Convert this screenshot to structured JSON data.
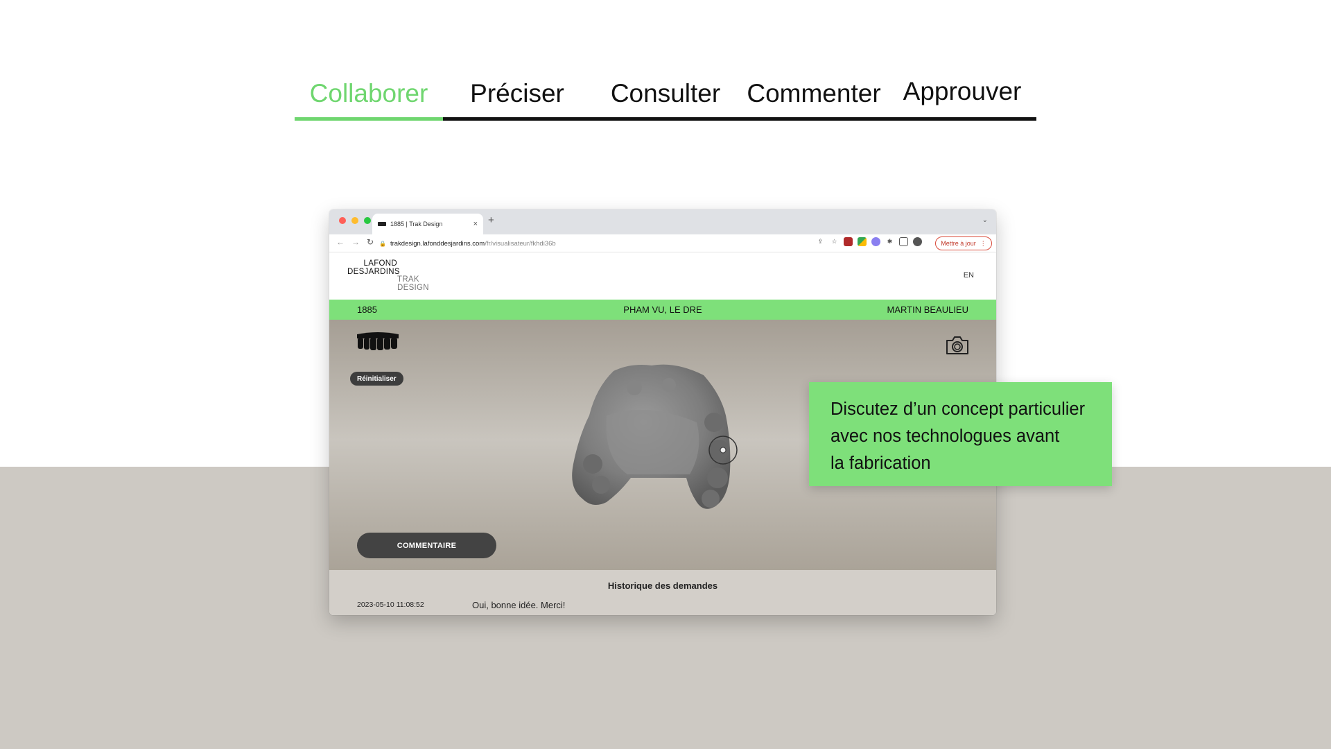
{
  "tabs": [
    {
      "label": "Collaborer",
      "active": true
    },
    {
      "label": "Préciser",
      "active": false
    },
    {
      "label": "Consulter",
      "active": false
    },
    {
      "label": "Commenter",
      "active": false
    },
    {
      "label": "Approuver",
      "active": false
    }
  ],
  "browser": {
    "tab_title": "1885 | Trak Design",
    "new_tab": "+",
    "close": "×",
    "url_host": "trakdesign.lafonddesjardins.com",
    "url_path": "/fr/visualisateur/fkhdi36b",
    "update_label": "Mettre à jour"
  },
  "site": {
    "logo_line1": "LAFOND DESJARDINS",
    "logo_line2": "TRAK DESIGN",
    "lang": "EN"
  },
  "case": {
    "number": "1885",
    "doctor": "PHAM VU, LE DRE",
    "patient": "MARTIN BEAULIEU"
  },
  "viewer": {
    "reset_label": "Réinitialiser",
    "comment_label": "COMMENTAIRE"
  },
  "history": {
    "title": "Historique des demandes",
    "entries": [
      {
        "date": "2023-05-10 11:08:52",
        "message": "Oui, bonne idée. Merci!"
      }
    ]
  },
  "callout": {
    "line1": "Discutez d’un concept particulier",
    "line2": "avec nos technologues avant",
    "line3": "la fabrication"
  },
  "colors": {
    "accent_green": "#7ee07a",
    "tab_active": "#6fd66f",
    "floor": "#cdc9c3"
  }
}
